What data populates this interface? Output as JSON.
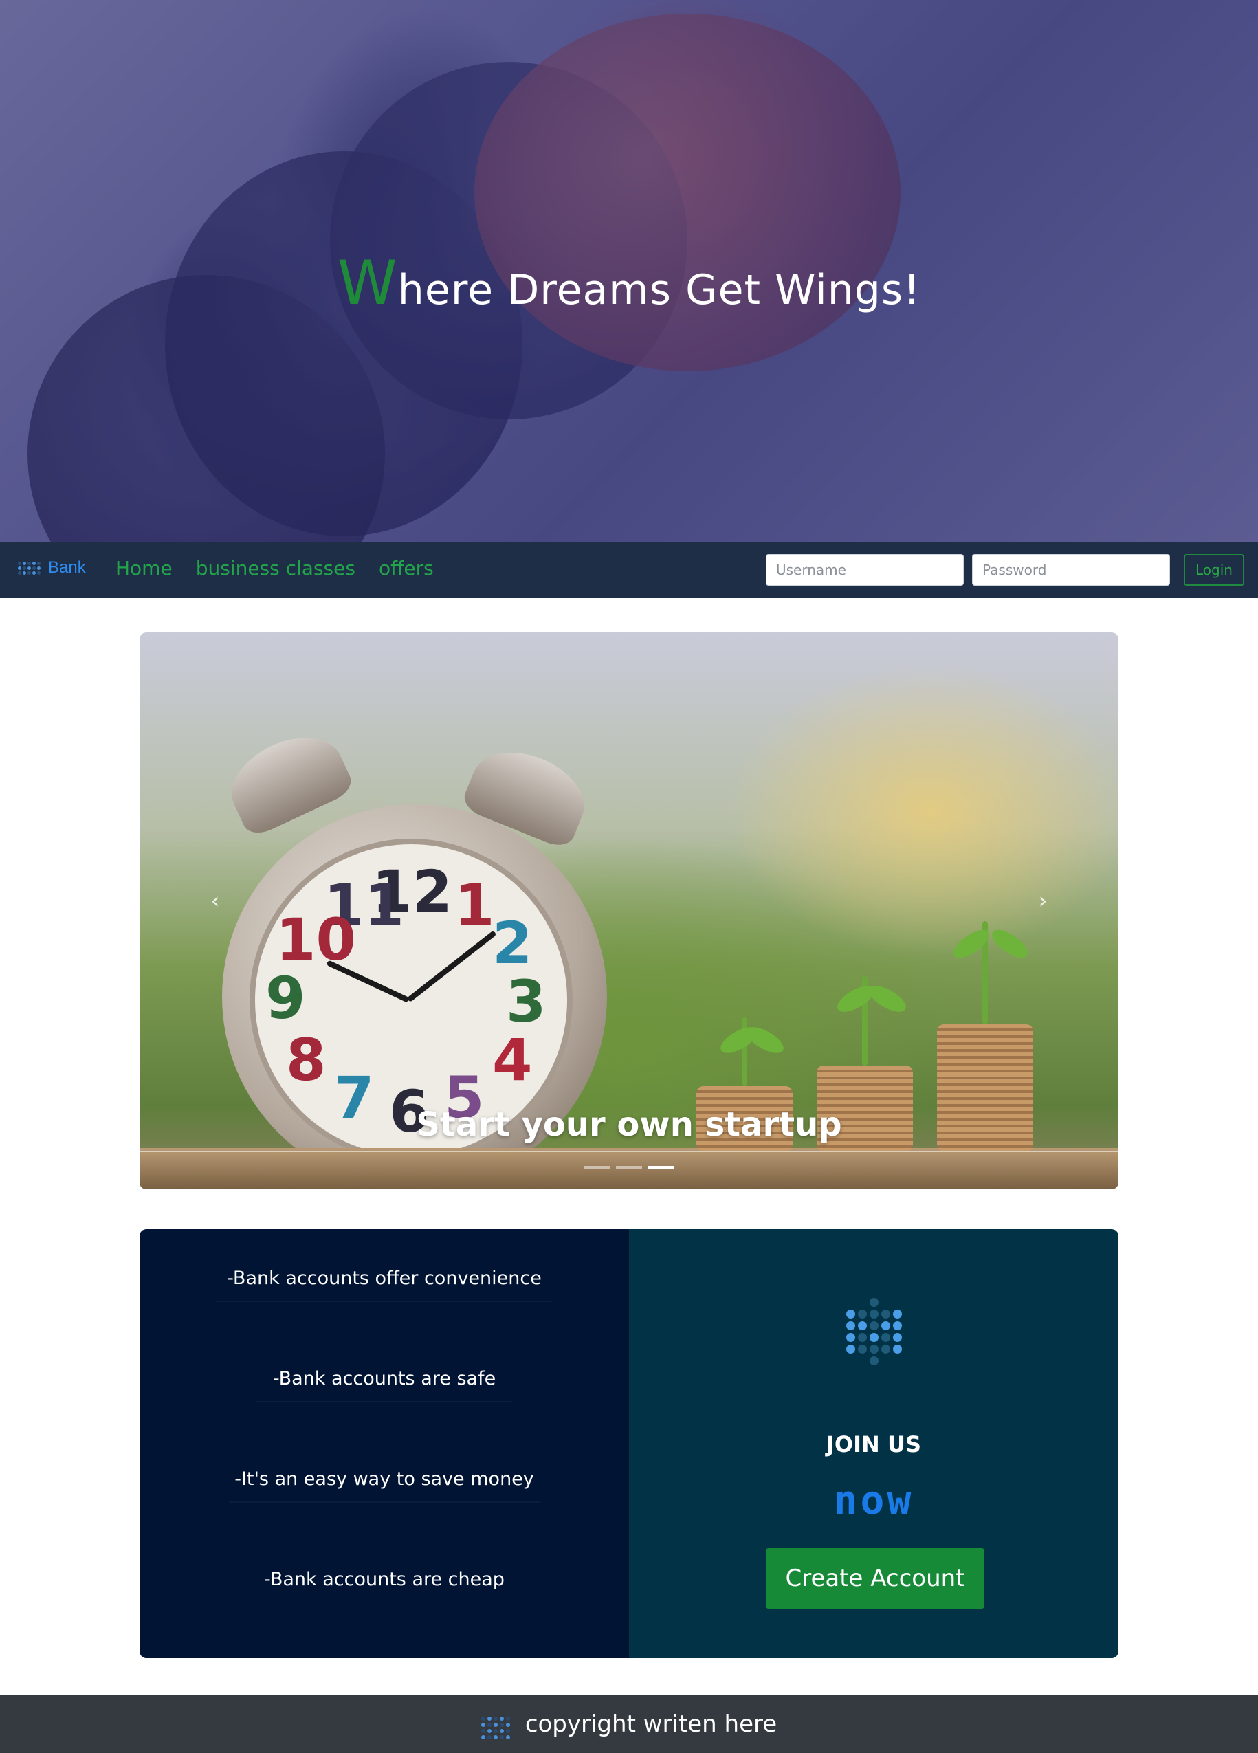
{
  "hero": {
    "title_first_letter": "W",
    "title_rest": "here Dreams Get Wings!"
  },
  "navbar": {
    "brand": "Bank",
    "links": [
      "Home",
      "business classes",
      "offers"
    ],
    "username_placeholder": "Username",
    "password_placeholder": "Password",
    "login_label": "Login"
  },
  "carousel": {
    "caption": "Start your own startup",
    "prev_icon": "chevron-left-icon",
    "next_icon": "chevron-right-icon",
    "prev_glyph": "‹",
    "next_glyph": "›",
    "slides": 3,
    "active_slide": 3
  },
  "benefits": [
    "-Bank accounts offer convenience",
    "-Bank accounts are safe",
    "-It's an easy way to save money",
    "-Bank accounts are cheap"
  ],
  "join": {
    "title": "JOIN US",
    "now": "now",
    "button": "Create Account"
  },
  "footer": {
    "text": "copyright writen here"
  },
  "colors": {
    "navbar_bg": "#1f2e47",
    "nav_link": "#22a54a",
    "brand_blue": "#2f8bf0",
    "info_left_bg": "#021433",
    "info_right_bg": "#023246",
    "create_button_bg": "#168a36",
    "now_text": "#1a7be8",
    "footer_bg": "#343a40"
  }
}
